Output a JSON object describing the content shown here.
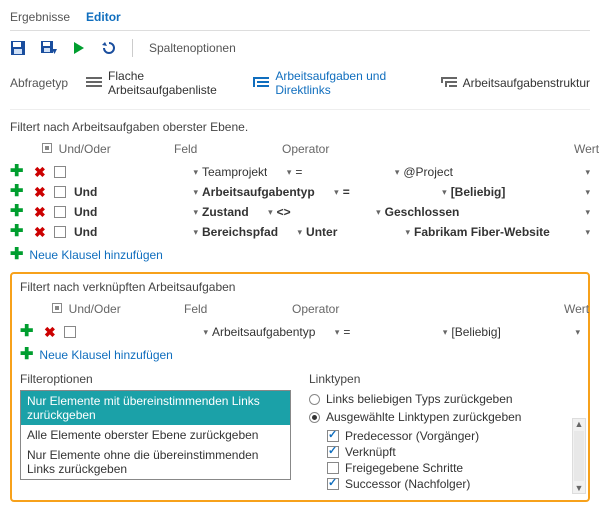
{
  "tabs": {
    "results": "Ergebnisse",
    "editor": "Editor"
  },
  "toolbar": {
    "column_options": "Spaltenoptionen"
  },
  "querytype": {
    "label": "Abfragetyp",
    "flat": "Flache Arbeitsaufgabenliste",
    "direct": "Arbeitsaufgaben und Direktlinks",
    "tree": "Arbeitsaufgabenstruktur"
  },
  "filters_top_title": "Filtert nach Arbeitsaufgaben oberster Ebene.",
  "filter_headers": {
    "andor": "Und/Oder",
    "field": "Feld",
    "operator": "Operator",
    "value": "Wert"
  },
  "rows_top": [
    {
      "andor": "",
      "field": "Teamprojekt",
      "operator": "=",
      "value": "@Project",
      "bold": false
    },
    {
      "andor": "Und",
      "field": "Arbeitsaufgabentyp",
      "operator": "=",
      "value": "[Beliebig]",
      "bold": true
    },
    {
      "andor": "Und",
      "field": "Zustand",
      "operator": "<>",
      "value": "Geschlossen",
      "bold": true
    },
    {
      "andor": "Und",
      "field": "Bereichspfad",
      "operator": "Unter",
      "value": "Fabrikam Fiber-Website",
      "bold": true
    }
  ],
  "add_clause": "Neue Klausel hinzufügen",
  "filters_linked_title": "Filtert nach verknüpften Arbeitsaufgaben",
  "rows_linked": [
    {
      "andor": "",
      "field": "Arbeitsaufgabentyp",
      "operator": "=",
      "value": "[Beliebig]",
      "bold": false
    }
  ],
  "filter_options": {
    "title": "Filteroptionen",
    "items": [
      "Nur Elemente mit übereinstimmenden Links zurückgeben",
      "Alle Elemente oberster Ebene zurückgeben",
      "Nur Elemente ohne die übereinstimmenden Links zurückgeben"
    ],
    "selected_index": 0
  },
  "link_types": {
    "title": "Linktypen",
    "any": "Links beliebigen Typs zurückgeben",
    "selected": "Ausgewählte Linktypen zurückgeben",
    "mode_selected": true,
    "items": [
      {
        "label": "Predecessor (Vorgänger)",
        "checked": true
      },
      {
        "label": "Verknüpft",
        "checked": true
      },
      {
        "label": "Freigegebene Schritte",
        "checked": false
      },
      {
        "label": "Successor (Nachfolger)",
        "checked": true
      }
    ]
  }
}
